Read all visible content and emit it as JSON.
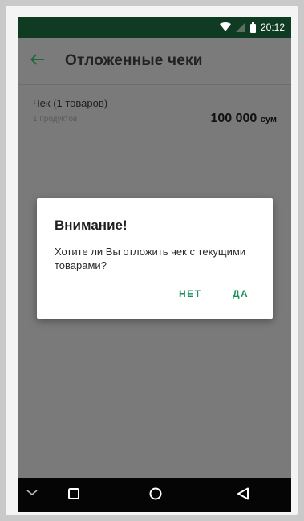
{
  "status_bar": {
    "time": "20:12",
    "icons": [
      "wifi-icon",
      "signal-icon",
      "battery-icon"
    ]
  },
  "app_bar": {
    "back_icon": "arrow-left-icon",
    "title": "Отложенные чеки"
  },
  "list": {
    "items": [
      {
        "title": "Чек (1 товаров)",
        "subtitle": "1 продуктов",
        "amount": "100 000",
        "currency": "сум"
      }
    ]
  },
  "dialog": {
    "title": "Внимание!",
    "message": "Хотите ли Вы отложить чек с текущими товарами?",
    "negative_label": "НЕТ",
    "positive_label": "ДА"
  },
  "nav_bar": {
    "icons": [
      "keyboard-hide-icon",
      "recents-icon",
      "home-icon",
      "back-icon"
    ]
  },
  "colors": {
    "status_bar_bg": "#0f3b22",
    "accent": "#1a8f5a",
    "scrim": "#7a7a7a",
    "nav_bar_bg": "#050505"
  }
}
